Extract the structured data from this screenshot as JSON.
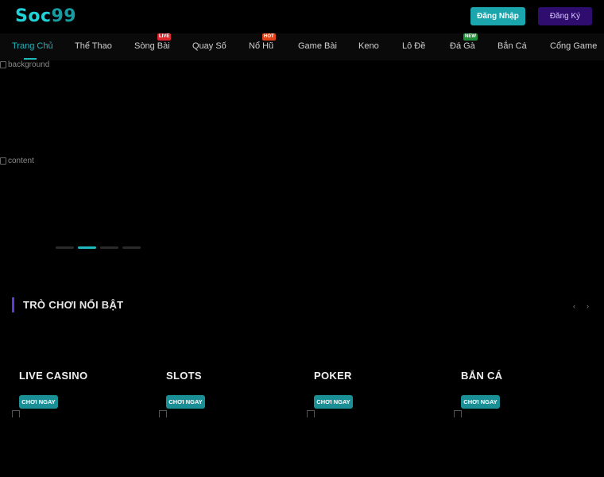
{
  "header": {
    "logo_part1": "Soc",
    "logo_part2": "99",
    "login_label": "Đăng Nhập",
    "register_label": "Đăng Ký"
  },
  "nav": {
    "items": [
      {
        "label": "Trang Chủ"
      },
      {
        "label": "Thể Thao"
      },
      {
        "label": "Sòng Bài",
        "badge": "LIVE"
      },
      {
        "label": "Quay Số"
      },
      {
        "label": "Nổ Hũ",
        "badge": "HOT"
      },
      {
        "label": "Game Bài"
      },
      {
        "label": "Keno"
      },
      {
        "label": "Lô Đề"
      },
      {
        "label": "Đá Gà",
        "badge": "NEW"
      },
      {
        "label": "Bắn Cá"
      },
      {
        "label": "Cổng Game"
      }
    ]
  },
  "banner": {
    "background_alt": "background",
    "content_alt": "content",
    "active_slide": 2,
    "slide_count": 4
  },
  "featured": {
    "title": "TRÒ CHƠI NỔI BẬT",
    "prev_icon": "‹",
    "next_icon": "›",
    "cards": [
      {
        "title": "LIVE CASINO",
        "button": "CHƠI NGAY"
      },
      {
        "title": "SLOTS",
        "button": "CHƠI NGAY"
      },
      {
        "title": "POKER",
        "button": "CHƠI NGAY"
      },
      {
        "title": "BẮN CÁ",
        "button": "CHƠI NGAY"
      }
    ]
  }
}
